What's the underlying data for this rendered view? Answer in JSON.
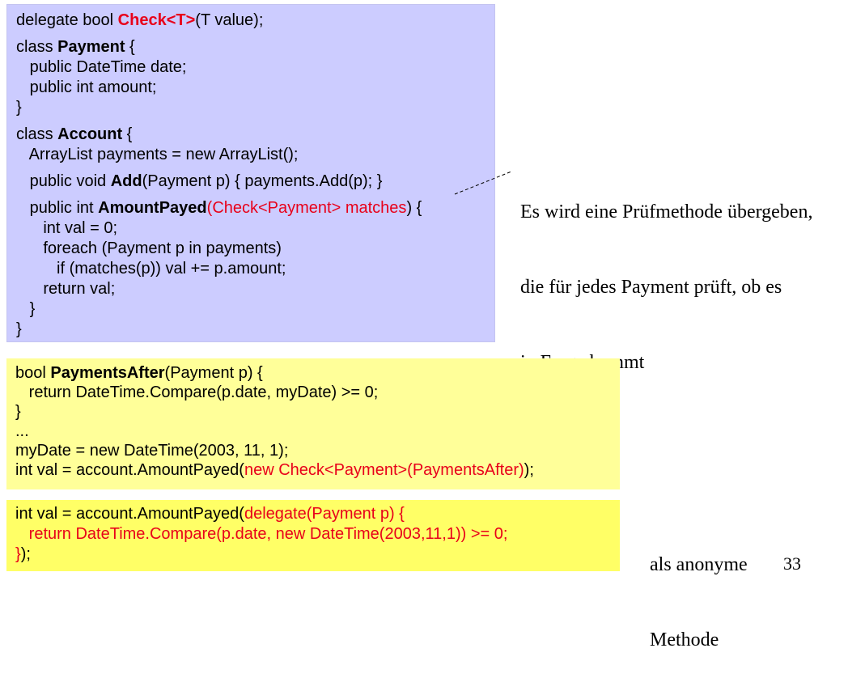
{
  "code_block_1": {
    "delegate_prefix": "delegate bool ",
    "delegate_name": "Check<T>",
    "delegate_suffix": "(T value);",
    "payment_class_prefix": "class ",
    "payment_class_name": "Payment",
    "payment_class_suffix": " {",
    "payment_field_date": "   public DateTime date;",
    "payment_field_amount": "   public int amount;",
    "payment_close": "}",
    "account_class_prefix": "class ",
    "account_class_name": "Account",
    "account_class_suffix": " {",
    "payments_field": "   ArrayList payments = new ArrayList();",
    "add_prefix": "   public void ",
    "add_name": "Add",
    "add_suffix": "(Payment p) { payments.Add(p); }",
    "amount_prefix": "   public int ",
    "amount_name": "AmountPayed",
    "amount_paren_open": "(",
    "amount_param": "Check<Payment> matches",
    "amount_paren_close": ") {",
    "val_init": "      int val = 0;",
    "foreach_line": "      foreach (Payment p in payments)",
    "if_line": "         if (matches(p)) val += p.amount;",
    "return_line": "      return val;",
    "method_close": "   }",
    "class_close": "}"
  },
  "code_block_2": {
    "bool_prefix": "bool ",
    "bool_name": "PaymentsAfter",
    "bool_suffix": "(Payment p) {",
    "return_line": "   return DateTime.Compare(p.date, myDate) >= 0;",
    "close": "}",
    "ellipsis": "...",
    "mydate_line": "myDate = new DateTime(2003, 11, 1);",
    "val_prefix": "int val = account.AmountPayed(",
    "val_red": "new Check<Payment>(PaymentsAfter)",
    "val_suffix": ");"
  },
  "code_block_3": {
    "val_prefix": "int val = account.AmountPayed(",
    "val_red": "delegate(Payment p) {",
    "return_red": "   return DateTime.Compare(p.date, new DateTime(2003,11,1)) >= 0;",
    "close_red": "}",
    "close_black": ");"
  },
  "annotation_top": {
    "line1": "Es wird eine Prüfmethode übergeben,",
    "line2": "die für jedes Payment prüft, ob es",
    "line3": "in Frage kommt"
  },
  "annotation_bottom": {
    "line1": "als anonyme",
    "line2": "Methode"
  },
  "page_number": "33",
  "colors": {
    "blue_box": "#ccccff",
    "yellow_box_light": "#ffff99",
    "yellow_box": "#ffff66",
    "highlight_red": "#e8001a"
  }
}
